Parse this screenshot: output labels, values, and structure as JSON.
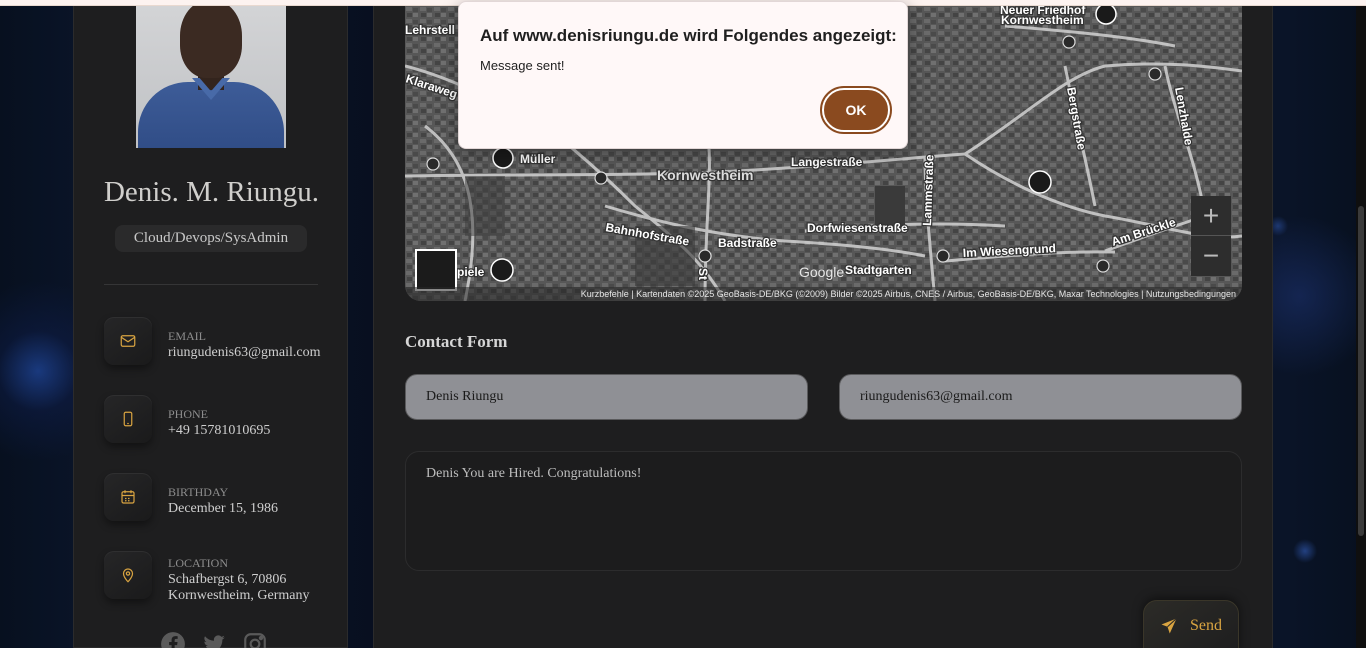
{
  "dialog": {
    "title": "Auf www.denisriungu.de wird Folgendes angezeigt:",
    "message": "Message sent!",
    "ok_label": "OK"
  },
  "profile": {
    "name": "Denis. M. Riungu.",
    "role": "Cloud/Devops/SysAdmin",
    "contacts": [
      {
        "label": "EMAIL",
        "value": "riungudenis63@gmail.com",
        "icon": "mail-icon"
      },
      {
        "label": "PHONE",
        "value": "+49 15781010695",
        "icon": "phone-icon"
      },
      {
        "label": "BIRTHDAY",
        "value": "December 15, 1986",
        "icon": "calendar-icon"
      },
      {
        "label": "LOCATION",
        "value": "Schafbergst 6, 70806 Kornwestheim, Germany",
        "icon": "location-pin-icon"
      }
    ],
    "social": [
      "facebook-icon",
      "twitter-icon",
      "instagram-icon"
    ]
  },
  "map": {
    "labels": {
      "kornwestheim": "Kornwestheim",
      "langestrasse": "Langestraße",
      "bahnhofstrasse": "Bahnhofstraße",
      "badstrasse": "Badstraße",
      "dorfwiesenstrasse": "Dorfwiesenstraße",
      "im_wiesengrund": "Im Wiesengrund",
      "am_bruckle": "Am Brückle",
      "stadtgarten": "Stadtgarten",
      "lammstrasse": "Lammstraße",
      "bergstrasse": "Bergstraße",
      "lenzhalde": "Lenzhalde",
      "muller": "Müller",
      "klaraweg": "Klaraweg",
      "lehrstell": "Lehrstell",
      "neuer_friedhof": "Neuer Friedhof",
      "kornwestheim_top": "Kornwestheim",
      "spiele": "piele",
      "st": "St"
    },
    "zoom_in": "+",
    "zoom_out": "−",
    "google": "Google",
    "attribution": "Kurzbefehle  |  Kartendaten ©2025 GeoBasis-DE/BKG (©2009) Bilder ©2025 Airbus, CNES / Airbus, GeoBasis-DE/BKG, Maxar Technologies  |  Nutzungsbedingungen"
  },
  "form": {
    "title": "Contact Form",
    "name_value": "Denis Riungu",
    "email_value": "riungudenis63@gmail.com",
    "message_value": "Denis You are Hired. Congratulations!",
    "send_label": "Send"
  },
  "colors": {
    "accent": "#d9a441",
    "ok_button": "#8a4a1f",
    "panel": "#1e1e1f"
  }
}
